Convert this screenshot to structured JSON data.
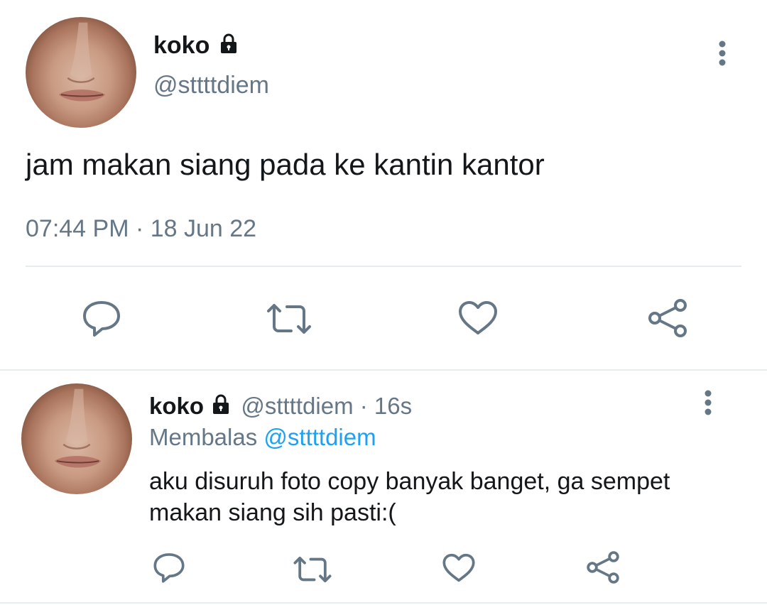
{
  "colors": {
    "text": "#14171a",
    "muted": "#657786",
    "link": "#1da1f2",
    "divider": "#e6ecf0"
  },
  "main_tweet": {
    "display_name": "koko",
    "handle": "@sttttdiem",
    "text": "jam makan siang pada ke kantin kantor",
    "timestamp": "07:44 PM · 18 Jun 22",
    "locked_icon": "lock-icon",
    "actions": [
      "reply-icon",
      "retweet-icon",
      "like-icon",
      "share-icon"
    ]
  },
  "reply_tweet": {
    "display_name": "koko",
    "handle": "@sttttdiem",
    "separator": "·",
    "age": "16s",
    "replying_prefix": "Membalas",
    "replying_to": "@sttttdiem",
    "text_line1": "aku disuruh foto copy banyak banget, ga sempet",
    "text_line2": "makan siang sih pasti:(",
    "actions": [
      "reply-icon",
      "retweet-icon",
      "like-icon",
      "share-icon"
    ]
  }
}
